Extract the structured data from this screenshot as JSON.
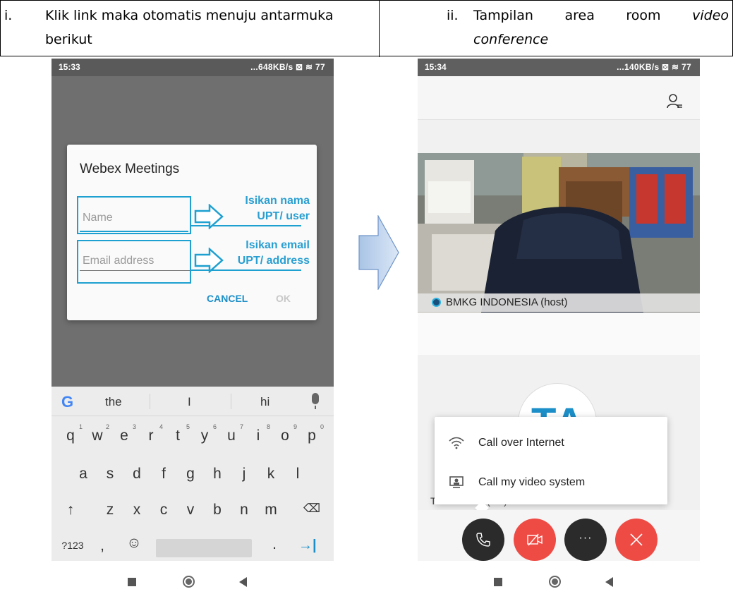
{
  "header": {
    "col1_number": "i.",
    "col1_line1": "Klik link maka otomatis menuju antarmuka",
    "col1_line2": "berikut",
    "col2_number": "ii.",
    "col2_w1": "Tampilan",
    "col2_w2": "area",
    "col2_w3": "room",
    "col2_w4": "video",
    "col2_line2": "conference"
  },
  "phone1": {
    "status": {
      "time": "15:33",
      "right": "...648KB/s ⊠ ≋ 77"
    },
    "dialog": {
      "title": "Webex Meetings",
      "name_placeholder": "Name",
      "email_placeholder": "Email address",
      "note1_line1": "Isikan nama",
      "note1_line2": "UPT/ user",
      "note2_line1": "Isikan email",
      "note2_line2": "UPT/ address",
      "cancel": "CANCEL",
      "ok": "OK"
    },
    "keyboard": {
      "suggestions": [
        "the",
        "I",
        "hi"
      ],
      "row1": [
        "q",
        "w",
        "e",
        "r",
        "t",
        "y",
        "u",
        "i",
        "o",
        "p"
      ],
      "row1_hints": [
        "1",
        "2",
        "3",
        "4",
        "5",
        "6",
        "7",
        "8",
        "9",
        "0"
      ],
      "row2": [
        "a",
        "s",
        "d",
        "f",
        "g",
        "h",
        "j",
        "k",
        "l"
      ],
      "row3": [
        "↑",
        "z",
        "x",
        "c",
        "v",
        "b",
        "n",
        "m",
        "⌫"
      ],
      "row4_left": "?123",
      "comma": ",",
      "emoji": "☺",
      "period": ".",
      "enter": "→|"
    }
  },
  "phone2": {
    "status": {
      "time": "15:34",
      "right": "...140KB/s ⊠ ≋ 77"
    },
    "video_label": "BMKG INDONESIA (host)",
    "avatar_initials": "TA",
    "self_label": "Test android (me)",
    "popup": {
      "item1": "Call over Internet",
      "item2": "Call my video system"
    },
    "more_label": "···"
  },
  "colors": {
    "accent": "#1ea0d0",
    "red": "#ef4b45",
    "dark": "#2b2b2b"
  }
}
